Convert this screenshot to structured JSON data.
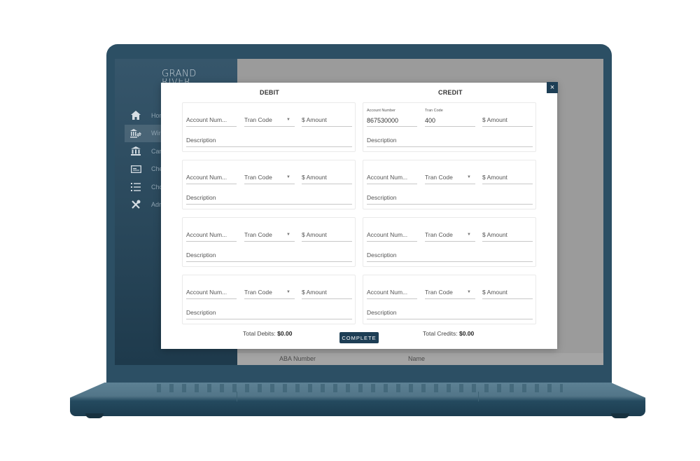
{
  "app": {
    "logo_line1": "GRAND",
    "logo_line2": "RIVER"
  },
  "sidebar": {
    "items": [
      {
        "label": "Home",
        "icon": "home-icon",
        "glyph": "⌂",
        "active": false
      },
      {
        "label": "Wires",
        "icon": "wire-transfer-icon",
        "glyph": "⇄",
        "active": true
      },
      {
        "label": "Cancel",
        "icon": "bank-icon",
        "glyph": "🏛",
        "active": false
      },
      {
        "label": "Checks",
        "icon": "check-card-icon",
        "glyph": "▭",
        "active": false
      },
      {
        "label": "Choices",
        "icon": "list-icon",
        "glyph": "☰",
        "active": false
      },
      {
        "label": "Admin",
        "icon": "tools-icon",
        "glyph": "✕",
        "active": false
      }
    ]
  },
  "background_table": {
    "columns": [
      "ABA Number",
      "Name"
    ]
  },
  "modal": {
    "close_label": "×",
    "debit_title": "DEBIT",
    "credit_title": "CREDIT",
    "placeholders": {
      "account": "Account Num...",
      "tran_code": "Tran Code",
      "amount": "$ Amount",
      "description": "Description"
    },
    "debit_entries": [
      {
        "account": "",
        "tran_code": "",
        "amount": "",
        "description": ""
      },
      {
        "account": "",
        "tran_code": "",
        "amount": "",
        "description": ""
      },
      {
        "account": "",
        "tran_code": "",
        "amount": "",
        "description": ""
      },
      {
        "account": "",
        "tran_code": "",
        "amount": "",
        "description": ""
      }
    ],
    "credit_entries": [
      {
        "account_label": "Account Number",
        "account": "867530000",
        "tran_code_label": "Tran Code",
        "tran_code": "400",
        "amount": "",
        "description": ""
      },
      {
        "account": "",
        "tran_code": "",
        "amount": "",
        "description": ""
      },
      {
        "account": "",
        "tran_code": "",
        "amount": "",
        "description": ""
      },
      {
        "account": "",
        "tran_code": "",
        "amount": "",
        "description": ""
      }
    ],
    "total_debits_label": "Total Debits:",
    "total_debits_value": "$0.00",
    "total_credits_label": "Total Credits:",
    "total_credits_value": "$0.00",
    "complete_label": "COMPLETE"
  },
  "colors": {
    "primary": "#1d3e55",
    "laptop_body": "#2c4f64",
    "overlay": "#9b9b9b"
  }
}
